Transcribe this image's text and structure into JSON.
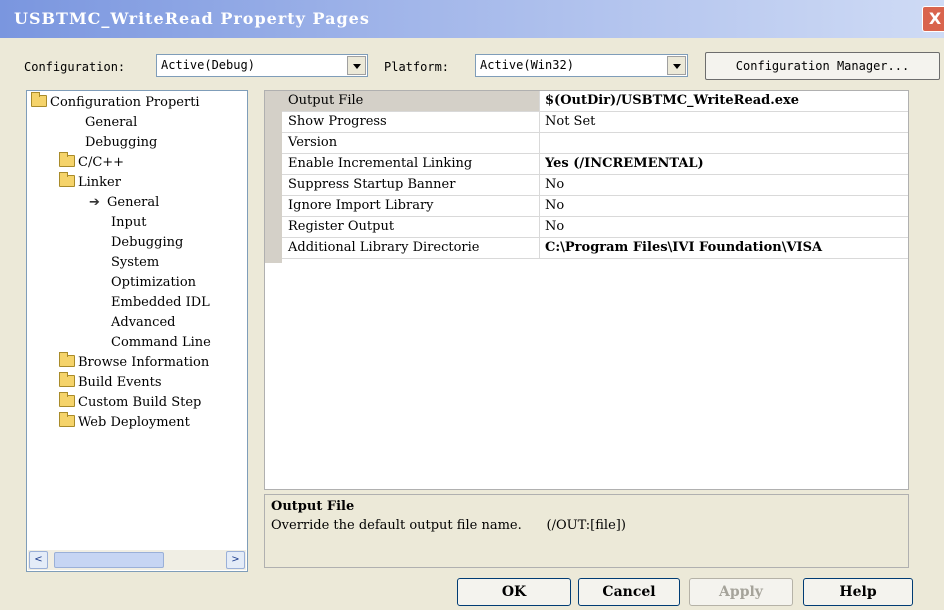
{
  "window": {
    "title": "USBTMC_WriteRead Property Pages",
    "close_glyph": "X"
  },
  "toolbar": {
    "configuration_label": "Configuration:",
    "configuration_value": "Active(Debug)",
    "platform_label": "Platform:",
    "platform_value": "Active(Win32)",
    "config_manager_label": "Configuration Manager..."
  },
  "tree": {
    "items": [
      {
        "label": "Configuration Properti",
        "icon": "open-folder-icon"
      },
      {
        "label": "General"
      },
      {
        "label": "Debugging"
      },
      {
        "label": "C/C++",
        "icon": "folder-icon"
      },
      {
        "label": "Linker",
        "icon": "open-folder-icon"
      },
      {
        "label": "General",
        "icon": "arrow-icon"
      },
      {
        "label": "Input"
      },
      {
        "label": "Debugging"
      },
      {
        "label": "System"
      },
      {
        "label": "Optimization"
      },
      {
        "label": "Embedded IDL"
      },
      {
        "label": "Advanced"
      },
      {
        "label": "Command Line"
      },
      {
        "label": "Browse Information",
        "icon": "folder-icon"
      },
      {
        "label": "Build Events",
        "icon": "folder-icon"
      },
      {
        "label": "Custom Build Step",
        "icon": "folder-icon"
      },
      {
        "label": "Web Deployment",
        "icon": "folder-icon"
      }
    ],
    "scroll_left": "<",
    "scroll_right": ">"
  },
  "properties": [
    {
      "name": "Output File",
      "value": "$(OutDir)/USBTMC_WriteRead.exe"
    },
    {
      "name": "Show Progress",
      "value": "Not Set"
    },
    {
      "name": "Version",
      "value": ""
    },
    {
      "name": "Enable Incremental Linking",
      "value": "Yes (/INCREMENTAL)"
    },
    {
      "name": "Suppress Startup Banner",
      "value": "No"
    },
    {
      "name": "Ignore Import Library",
      "value": "No"
    },
    {
      "name": "Register Output",
      "value": "No"
    },
    {
      "name": "Additional Library Directorie",
      "value": "C:\\Program Files\\IVI Foundation\\VISA"
    }
  ],
  "description": {
    "title": "Output File",
    "text": "Override the default output file name.      (/OUT:[file])"
  },
  "buttons": {
    "ok": "OK",
    "cancel": "Cancel",
    "apply": "Apply",
    "help": "Help"
  }
}
